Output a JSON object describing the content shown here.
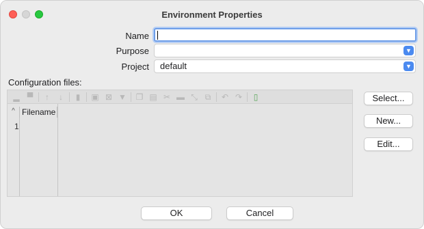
{
  "window": {
    "title": "Environment Properties"
  },
  "form": {
    "name_label": "Name",
    "name_value": "",
    "purpose_label": "Purpose",
    "purpose_value": "",
    "project_label": "Project",
    "project_value": "default"
  },
  "config": {
    "label": "Configuration files:",
    "table": {
      "sort_indicator": "^",
      "columns": [
        "Filename"
      ],
      "rows": [
        {
          "num": "1",
          "filename": ""
        }
      ]
    },
    "toolbar_icons": [
      "add-icon",
      "remove-icon",
      "move-up-icon",
      "move-down-icon",
      "delete-icon",
      "select-all-icon",
      "deselect-icon",
      "filter-icon",
      "copy-icon",
      "paste-icon",
      "cut-icon",
      "trash-icon",
      "collapse-icon",
      "duplicate-icon",
      "undo-icon",
      "redo-icon",
      "new-file-icon"
    ]
  },
  "side_buttons": {
    "select": "Select...",
    "new": "New...",
    "edit": "Edit..."
  },
  "footer": {
    "ok": "OK",
    "cancel": "Cancel"
  },
  "colors": {
    "accent": "#4b8af0",
    "focus_ring": "#6e9ee8",
    "close": "#fe5f57",
    "maximize": "#28c840"
  }
}
